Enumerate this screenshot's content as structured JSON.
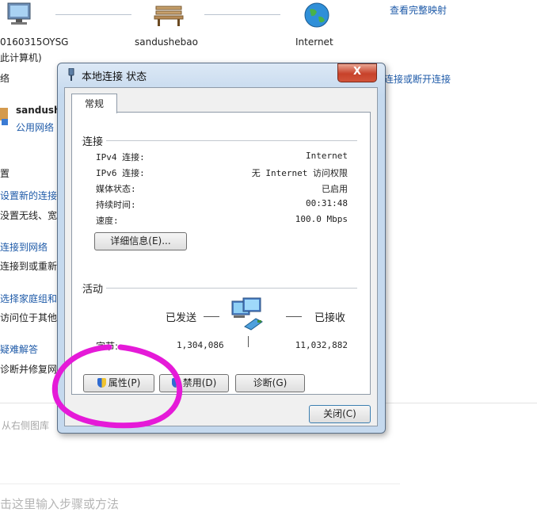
{
  "background": {
    "top_link_right": "查看完整映射",
    "node_left": "0160315OYSG",
    "node_left_sub": "此计算机)",
    "node_mid": "sandushebao",
    "node_right": "Internet",
    "left_label_1": "络",
    "link_right_2": "连接或断开连接",
    "network_name": "sandush",
    "network_type": "公用网络",
    "section_label": "置",
    "left_items": [
      "设置新的连接",
      "没置无线、宽",
      "连接到网络",
      "连接到或重新",
      "选择家庭组和",
      "访问位于其他",
      "疑难解答",
      "诊断并修复网"
    ],
    "hint_text": "从右侧图库",
    "bottom_input_placeholder": "击这里输入步骤或方法"
  },
  "dialog": {
    "title": "本地连接 状态",
    "close_glyph": "X",
    "tab_label": "常规",
    "connection_group": "连接",
    "rows": [
      {
        "label": "IPv4 连接:",
        "value": "Internet"
      },
      {
        "label": "IPv6 连接:",
        "value": "无 Internet 访问权限"
      },
      {
        "label": "媒体状态:",
        "value": "已启用"
      },
      {
        "label": "持续时间:",
        "value": "00:31:48"
      },
      {
        "label": "速度:",
        "value": "100.0 Mbps"
      }
    ],
    "details_button": "详细信息(E)...",
    "activity_group": "活动",
    "sent_label": "已发送",
    "received_label": "已接收",
    "bytes_label": "字节:",
    "bytes_sent": "1,304,086",
    "bytes_received": "11,032,882",
    "properties_button": "属性(P)",
    "disable_button": "禁用(D)",
    "diagnose_button": "诊断(G)",
    "close_button": "关闭(C)"
  },
  "colors": {
    "link": "#1e5aa8",
    "annotation_circle": "#e51ad8",
    "close_button": "#c7412a"
  }
}
